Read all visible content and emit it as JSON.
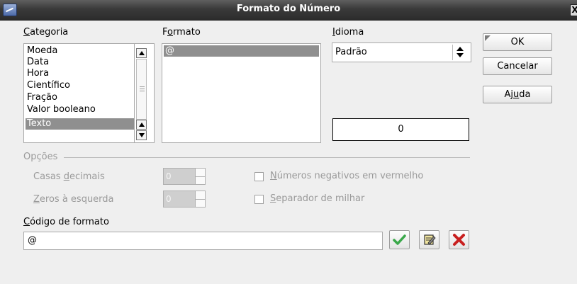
{
  "window": {
    "title": "Formato do Número"
  },
  "category": {
    "label_underlined": "C",
    "label_rest": "ategoria",
    "items": [
      "Moeda",
      "Data",
      "Hora",
      "Científico",
      "Fração",
      "Valor booleano",
      "Texto"
    ],
    "selected": "Texto"
  },
  "format": {
    "label_pre": "F",
    "label_underlined": "o",
    "label_rest": "rmato",
    "items": [
      "@"
    ]
  },
  "language": {
    "label_underlined": "I",
    "label_rest": "dioma",
    "value": "Padrão"
  },
  "preview": {
    "value": "0"
  },
  "buttons": {
    "ok": "OK",
    "cancel": "Cancelar",
    "help_pre": "Aj",
    "help_underlined": "u",
    "help_rest": "da"
  },
  "options": {
    "label": "Opções",
    "decimal_places_pre": "Casas ",
    "decimal_places_underlined": "d",
    "decimal_places_rest": "ecimais",
    "decimal_places_value": "0",
    "leading_zeros_underlined": "Z",
    "leading_zeros_rest": "eros à esquerda",
    "leading_zeros_value": "0",
    "negative_red_underlined": "N",
    "negative_red_rest": "úmeros negativos em vermelho",
    "thousands_sep_underlined": "S",
    "thousands_sep_rest": "eparador de milhar"
  },
  "format_code": {
    "label_underlined": "C",
    "label_rest": "ódigo de formato",
    "value": "@"
  },
  "icons": {
    "accept": "checkmark-icon",
    "edit_comment": "edit-comment-icon",
    "delete": "delete-icon",
    "accent_green": "#3aa84a",
    "accent_red": "#c82020"
  }
}
